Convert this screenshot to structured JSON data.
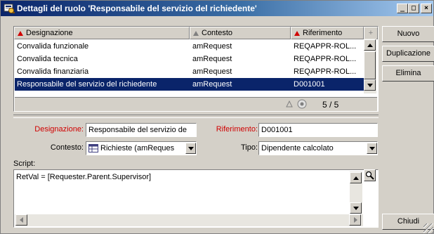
{
  "window": {
    "title": "Dettagli del ruolo 'Responsabile del servizio del richiedente'"
  },
  "list": {
    "columns": [
      "Designazione",
      "Contesto",
      "Riferimento"
    ],
    "rows": [
      {
        "designazione": "Convalida funzionale",
        "contesto": "amRequest",
        "riferimento": "REQAPPR-ROL..."
      },
      {
        "designazione": "Convalida tecnica",
        "contesto": "amRequest",
        "riferimento": "REQAPPR-ROL..."
      },
      {
        "designazione": "Convalida finanziaria",
        "contesto": "amRequest",
        "riferimento": "REQAPPR-ROL..."
      },
      {
        "designazione": "Responsabile del servizio del richiedente",
        "contesto": "amRequest",
        "riferimento": "D001001"
      }
    ],
    "pager": "5 / 5",
    "add_symbol": "+"
  },
  "buttons": {
    "new": "Nuovo",
    "duplicate": "Duplicazione",
    "delete": "Elimina",
    "close": "Chiudi"
  },
  "form": {
    "designazione_label": "Designazione:",
    "designazione_value": "Responsabile del servizio de",
    "riferimento_label": "Riferimento:",
    "riferimento_value": "D001001",
    "contesto_label": "Contesto:",
    "contesto_value": "Richieste (amReques",
    "tipo_label": "Tipo:",
    "tipo_value": "Dipendente calcolato",
    "script_label": "Script:",
    "script_value": "RetVal = [Requester.Parent.Supervisor]"
  },
  "colors": {
    "title_start": "#0a246a",
    "title_end": "#a6caf0",
    "selection": "#0a246a",
    "mandatory_label": "#d00000",
    "face": "#d4d0c8"
  }
}
